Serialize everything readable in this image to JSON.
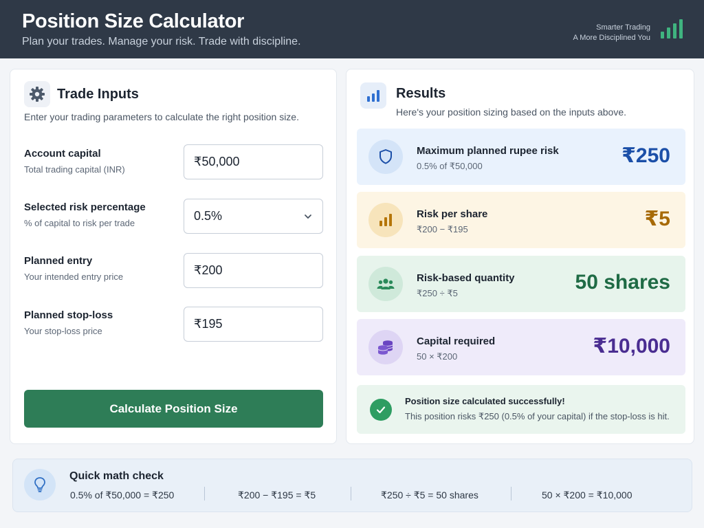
{
  "header": {
    "title": "Position Size Calculator",
    "subtitle": "Plan your trades. Manage your risk. Trade with discipline.",
    "brand_line1": "Smarter Trading",
    "brand_line2": "A More Disciplined You",
    "brand_icon": "bar-chart-logo-icon"
  },
  "inputs": {
    "title": "Trade Inputs",
    "icon": "gear-icon",
    "description": "Enter your trading parameters to calculate the right position size.",
    "fields": [
      {
        "label": "Account capital",
        "hint": "Total trading capital (INR)",
        "value": "₹50,000"
      },
      {
        "label": "Selected risk percentage",
        "hint": "% of capital to risk per trade",
        "value": "0.5%"
      },
      {
        "label": "Planned entry",
        "hint": "Your intended entry price",
        "value": "₹200"
      },
      {
        "label": "Planned stop-loss",
        "hint": "Your stop-loss price",
        "value": "₹195"
      }
    ],
    "button_label": "Calculate Position Size"
  },
  "results": {
    "title": "Results",
    "icon": "bar-chart-icon",
    "description": "Here's your position sizing based on the inputs above.",
    "cards": [
      {
        "label": "Maximum planned rupee risk",
        "sub": "0.5% of ₹50,000",
        "value": "₹250",
        "icon": "shield-icon",
        "color": "#1b4fa8",
        "bg": "#e9f2fd",
        "circle": "#d4e4f8"
      },
      {
        "label": "Risk per share",
        "sub": "₹200 − ₹195",
        "value": "₹5",
        "icon": "bar-chart-icon",
        "color": "#a76a06",
        "bg": "#fdf5e4",
        "circle": "#f7e4bb"
      },
      {
        "label": "Risk-based quantity",
        "sub": "₹250 ÷ ₹5",
        "value": "50 shares",
        "icon": "users-icon",
        "color": "#1f6b45",
        "bg": "#e7f4ec",
        "circle": "#cfe9da"
      },
      {
        "label": "Capital required",
        "sub": "50 × ₹200",
        "value": "₹10,000",
        "icon": "coins-icon",
        "color": "#4a2d91",
        "bg": "#efebfa",
        "circle": "#ded5f4"
      }
    ],
    "success_title": "Position size calculated successfully!",
    "success_text": "This position risks ₹250 (0.5% of your capital) if the stop-loss is hit."
  },
  "math_check": {
    "title": "Quick math check",
    "icon": "lightbulb-icon",
    "items": [
      "0.5% of ₹50,000 = ₹250",
      "₹200 − ₹195 = ₹5",
      "₹250 ÷ ₹5 = 50 shares",
      "50 × ₹200 = ₹10,000"
    ]
  }
}
